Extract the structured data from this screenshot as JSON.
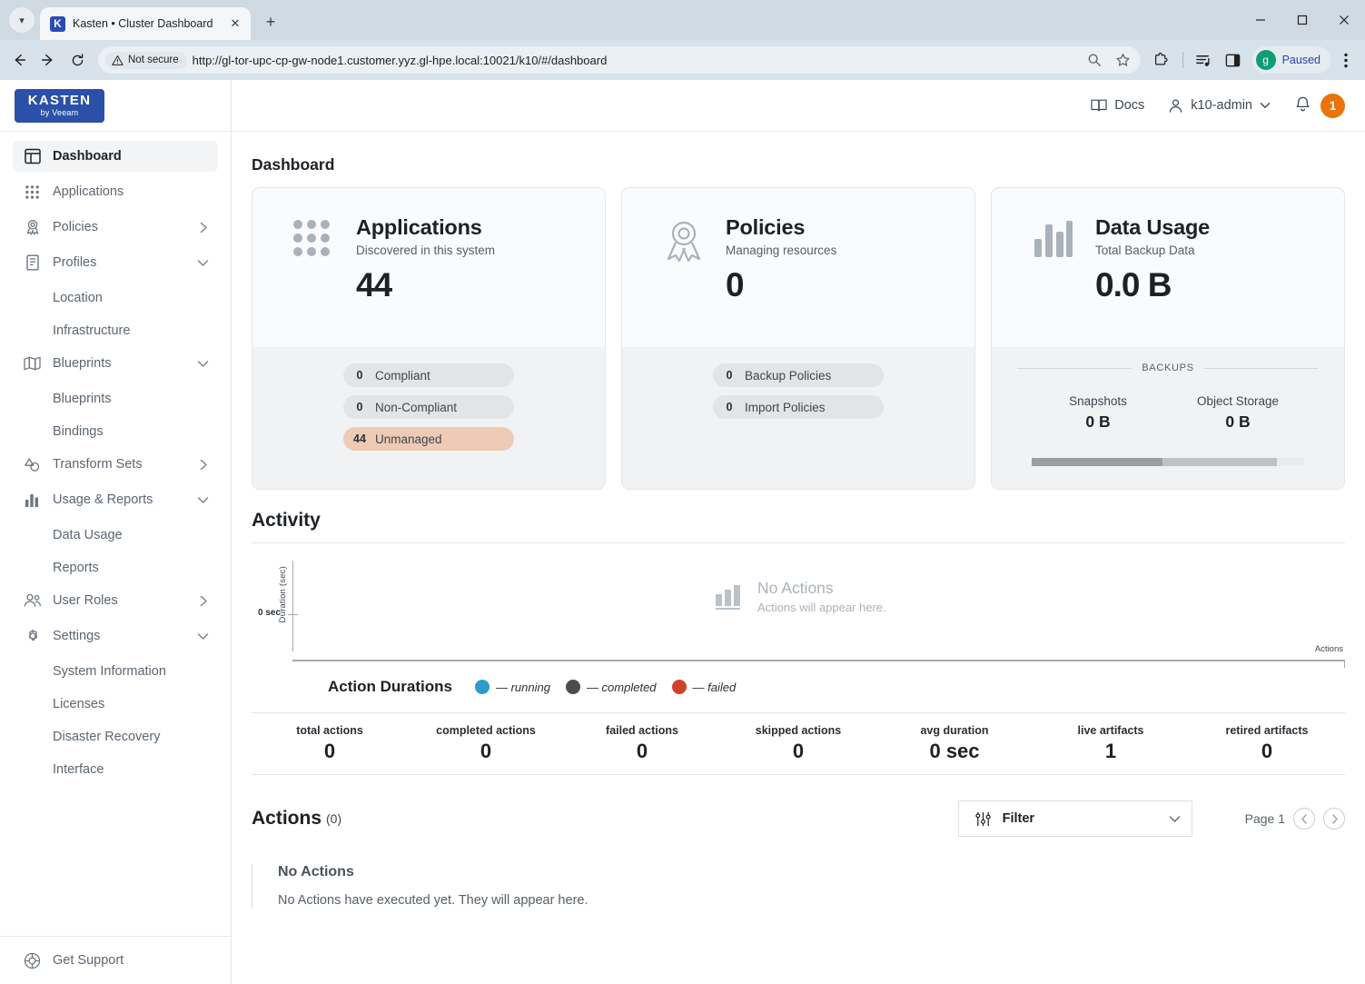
{
  "browser": {
    "tab": {
      "title": "Kasten • Cluster Dashboard",
      "favicon_letter": "K",
      "close_icon": "close-icon"
    },
    "new_tab_label": "+",
    "window_controls": {
      "minimize": "—",
      "maximize": "▢",
      "close": "✕"
    },
    "nav": {
      "back": "←",
      "forward": "→",
      "reload": "⟳"
    },
    "security_label": "Not secure",
    "url": "http://gl-tor-upc-cp-gw-node1.customer.yyz.gl-hpe.local:10021/k10/#/dashboard",
    "profile": {
      "initial": "g",
      "status": "Paused",
      "avatar_color": "#0f9d76"
    },
    "icons": [
      "zoom-icon",
      "bookmark-star-icon",
      "extensions-icon",
      "reading-list-icon",
      "side-panel-icon",
      "more-menu-icon"
    ]
  },
  "sidebar": {
    "logo": {
      "main": "KASTEN",
      "sub": "by Veeam",
      "color": "#2b50a8"
    },
    "items": [
      {
        "label": "Dashboard",
        "icon": "dashboard-icon",
        "active": true,
        "caret": ""
      },
      {
        "label": "Applications",
        "icon": "applications-grid-icon",
        "active": false,
        "caret": ""
      },
      {
        "label": "Policies",
        "icon": "policies-ribbon-icon",
        "active": false,
        "caret": "chevron-right-icon"
      },
      {
        "label": "Profiles",
        "icon": "profiles-doc-icon",
        "active": false,
        "caret": "chevron-down-icon"
      }
    ],
    "profiles_sub": [
      "Location",
      "Infrastructure"
    ],
    "blueprints": {
      "label": "Blueprints",
      "icon": "blueprints-map-icon",
      "caret": "chevron-down-icon"
    },
    "blueprints_sub": [
      "Blueprints",
      "Bindings"
    ],
    "transform_sets": {
      "label": "Transform Sets",
      "icon": "transform-sets-icon",
      "caret": "chevron-right-icon"
    },
    "usage_reports": {
      "label": "Usage & Reports",
      "icon": "usage-bar-icon",
      "caret": "chevron-down-icon"
    },
    "usage_sub": [
      "Data Usage",
      "Reports"
    ],
    "user_roles": {
      "label": "User Roles",
      "icon": "user-roles-icon",
      "caret": "chevron-right-icon"
    },
    "settings": {
      "label": "Settings",
      "icon": "gear-icon",
      "caret": "chevron-down-icon"
    },
    "settings_sub": [
      "System Information",
      "Licenses",
      "Disaster Recovery",
      "Interface"
    ],
    "support": {
      "label": "Get Support",
      "icon": "lifebuoy-icon"
    }
  },
  "topbar": {
    "docs": {
      "label": "Docs",
      "icon": "book-icon"
    },
    "user": {
      "label": "k10-admin",
      "icon": "user-icon",
      "caret": "chevron-down-icon"
    },
    "bell_icon": "bell-icon",
    "notification_count": "1",
    "badge_color": "#e8740c"
  },
  "main": {
    "page_title": "Dashboard",
    "cards": [
      {
        "icon": "applications-grid-icon",
        "title": "Applications",
        "subtitle": "Discovered in this system",
        "value": "44",
        "pills": [
          {
            "count": "0",
            "label": "Compliant",
            "highlight": false
          },
          {
            "count": "0",
            "label": "Non-Compliant",
            "highlight": false
          },
          {
            "count": "44",
            "label": "Unmanaged",
            "highlight": true
          }
        ]
      },
      {
        "icon": "policies-ribbon-icon",
        "title": "Policies",
        "subtitle": "Managing resources",
        "value": "0",
        "pills": [
          {
            "count": "0",
            "label": "Backup Policies",
            "highlight": false
          },
          {
            "count": "0",
            "label": "Import Policies",
            "highlight": false
          }
        ]
      },
      {
        "icon": "data-usage-bar-icon",
        "title": "Data Usage",
        "subtitle": "Total Backup Data",
        "value": "0.0 B",
        "divider_label": "BACKUPS",
        "backups": [
          {
            "label": "Snapshots",
            "value": "0 B"
          },
          {
            "label": "Object Storage",
            "value": "0 B"
          }
        ]
      }
    ],
    "activity": {
      "heading": "Activity",
      "chart": {
        "ylabel": "Duration (sec)",
        "ytick_label": "0 sec",
        "xlabel": "Actions",
        "empty_title": "No Actions",
        "empty_subtitle": "Actions will appear here.",
        "empty_icon": "bar-chart-icon"
      },
      "legend_title": "Action Durations",
      "legend": [
        {
          "label": "— running",
          "color": "#2d9cc8"
        },
        {
          "label": "— completed",
          "color": "#4c4c4c"
        },
        {
          "label": "— failed",
          "color": "#cf432c"
        }
      ],
      "stats": [
        {
          "label": "total actions",
          "value": "0"
        },
        {
          "label": "completed actions",
          "value": "0"
        },
        {
          "label": "failed actions",
          "value": "0"
        },
        {
          "label": "skipped actions",
          "value": "0"
        },
        {
          "label": "avg duration",
          "value": "0 sec"
        },
        {
          "label": "live artifacts",
          "value": "1"
        },
        {
          "label": "retired artifacts",
          "value": "0"
        }
      ]
    },
    "actions": {
      "title": "Actions",
      "count": "(0)",
      "filter": {
        "label": "Filter",
        "icon": "filter-sliders-icon",
        "caret": "chevron-down-icon"
      },
      "pager": {
        "label": "Page 1",
        "prev_icon": "chevron-left-circle-icon",
        "next_icon": "chevron-right-circle-icon"
      },
      "empty": {
        "title": "No Actions",
        "subtitle": "No Actions have executed yet. They will appear here."
      }
    }
  },
  "chart_data": {
    "type": "scatter",
    "title": "Action Durations",
    "xlabel": "Actions",
    "ylabel": "Duration (sec)",
    "x": [],
    "series": [
      {
        "name": "running",
        "values": [],
        "color": "#2d9cc8"
      },
      {
        "name": "completed",
        "values": [],
        "color": "#4c4c4c"
      },
      {
        "name": "failed",
        "values": [],
        "color": "#cf432c"
      }
    ],
    "ytick_labels": [
      "0 sec"
    ],
    "ylim": [
      0,
      0
    ],
    "grid": false,
    "legend_position": "bottom",
    "annotation": "No Actions — Actions will appear here."
  }
}
